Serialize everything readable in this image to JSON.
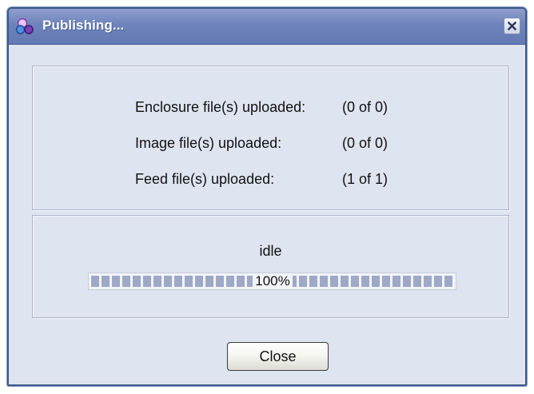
{
  "window": {
    "title": "Publishing...",
    "icon": "publish-app-icon",
    "close_icon": "close-icon"
  },
  "summary": {
    "rows": [
      {
        "label": "Enclosure file(s) uploaded:",
        "value": "(0 of 0)"
      },
      {
        "label": "Image file(s) uploaded:",
        "value": "(0 of 0)"
      },
      {
        "label": "Feed file(s) uploaded:",
        "value": "(1 of 1)"
      }
    ]
  },
  "progress": {
    "status": "idle",
    "percent_label": "100%",
    "percent": 100
  },
  "buttons": {
    "close_label": "Close"
  },
  "colors": {
    "titlebar": "#6f83bb",
    "dialog_background": "#dfe4f1",
    "progress_segment": "#9fa9c7"
  }
}
